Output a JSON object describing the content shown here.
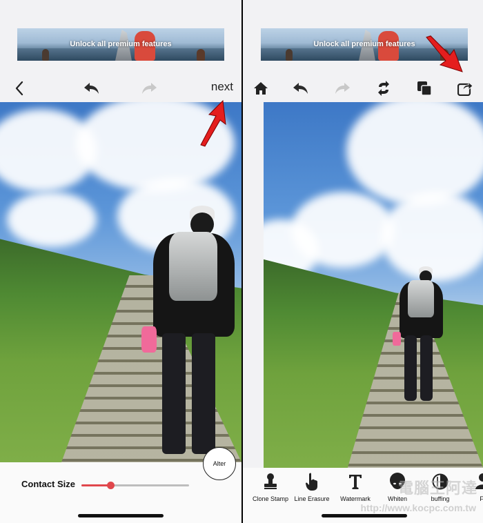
{
  "left_screen": {
    "banner": {
      "text": "Unlock all premium features"
    },
    "toolbar": {
      "back_icon": "chevron-left-icon",
      "undo_icon": "undo-arrow-icon",
      "redo_icon": "redo-arrow-icon",
      "next_label": "next"
    },
    "controls": {
      "size_label": "Contact Size",
      "slider_value": 0.27,
      "alter_label": "Alter"
    }
  },
  "right_screen": {
    "banner": {
      "text": "Unlock all premium features"
    },
    "toolbar": {
      "icons": [
        "home-icon",
        "undo-arrow-icon",
        "redo-arrow-icon",
        "swap-icon",
        "layers-icon",
        "share-icon"
      ]
    },
    "tools": [
      {
        "label": "Clone Stamp",
        "icon": "stamp-icon"
      },
      {
        "label": "Line Erasure",
        "icon": "hand-pointer-icon"
      },
      {
        "label": "Watermark",
        "icon": "text-t-icon"
      },
      {
        "label": "Whiten",
        "icon": "face-icon"
      },
      {
        "label": "buffing",
        "icon": "contrast-circle-icon"
      },
      {
        "label": "Fil",
        "icon": "person-icon"
      }
    ]
  },
  "watermark": {
    "text": "電腦王阿達",
    "url": "http://www.kocpc.com.tw"
  },
  "colors": {
    "accent": "#e0474c",
    "annotation_arrow": "#e41e1e",
    "background": "#f2f2f4"
  }
}
